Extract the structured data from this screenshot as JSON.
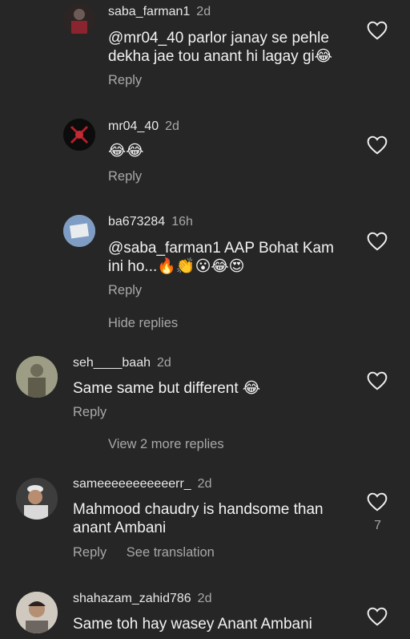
{
  "comments": [
    {
      "username": "saba_farman1",
      "time": "2d",
      "text": "@mr04_40 parlor janay se pehle dekha jae tou anant hi lagay gi😂",
      "reply": "Reply"
    },
    {
      "username": "mr04_40",
      "time": "2d",
      "text": "😂😂",
      "reply": "Reply"
    },
    {
      "username": "ba673284",
      "time": "16h",
      "text": "@saba_farman1 AAP Bohat Kam ini ho...🔥👏😮😂😍",
      "reply": "Reply"
    },
    {
      "username": "seh____baah",
      "time": "2d",
      "text": "Same same but different 😂",
      "reply": "Reply"
    },
    {
      "username": "sameeeeeeeeeeerr_",
      "time": "2d",
      "text": "Mahmood chaudry is handsome than anant Ambani",
      "reply": "Reply",
      "translate": "See translation",
      "likes": "7"
    },
    {
      "username": "shahazam_zahid786",
      "time": "2d",
      "text": "Same toh hay wasey Anant Ambani"
    }
  ],
  "hide_replies": "Hide replies",
  "view_more": "View 2 more replies",
  "colors": {
    "background": "#262626",
    "text": "#f2f2f2",
    "muted": "#a8a8a8"
  }
}
